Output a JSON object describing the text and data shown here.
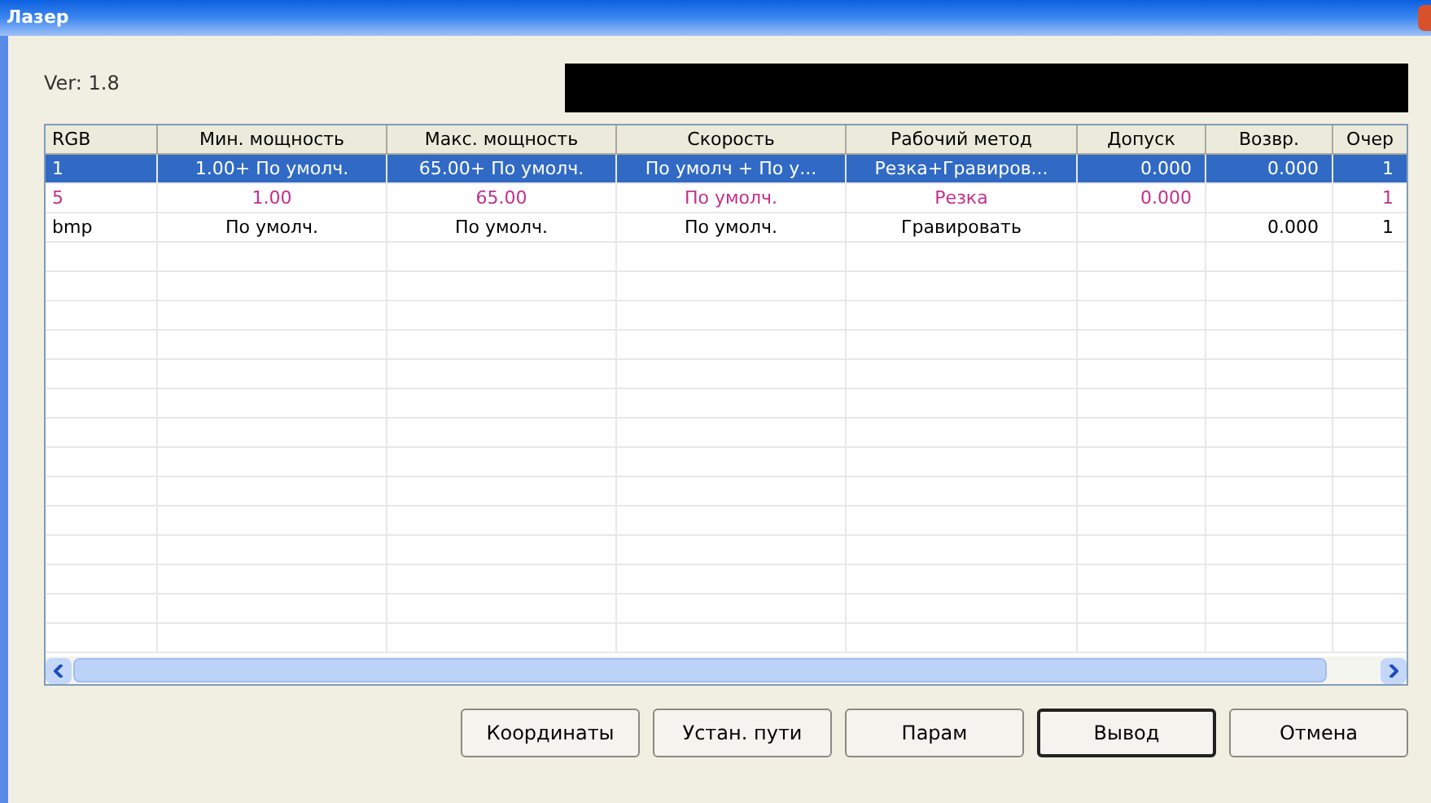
{
  "window": {
    "title": "Лазер"
  },
  "version": "Ver: 1.8",
  "table": {
    "columns": [
      "RGB",
      "Мин. мощность",
      "Макс. мощность",
      "Скорость",
      "Рабочий метод",
      "Допуск",
      "Возвр.",
      "Очер"
    ],
    "rows": [
      {
        "selected": true,
        "color": "#ffffff",
        "cells": [
          "1",
          "1.00+ По умолч.",
          "65.00+ По умолч.",
          "По умолч + По у...",
          "Резка+Гравиров...",
          "0.000",
          "0.000",
          "1"
        ]
      },
      {
        "selected": false,
        "color": "#c42f8c",
        "cells": [
          "5",
          "1.00",
          "65.00",
          "По умолч.",
          "Резка",
          "0.000",
          null,
          "1"
        ]
      },
      {
        "selected": false,
        "color": "#000000",
        "cells": [
          "bmp",
          "По умолч.",
          "По умолч.",
          "По умолч.",
          "Гравировать",
          null,
          "0.000",
          "1"
        ]
      }
    ]
  },
  "buttons": [
    {
      "label": "Координаты",
      "default": false
    },
    {
      "label": "Устан. пути",
      "default": false
    },
    {
      "label": "Парам",
      "default": false
    },
    {
      "label": "Вывод",
      "default": true
    },
    {
      "label": "Отмена",
      "default": false
    }
  ]
}
